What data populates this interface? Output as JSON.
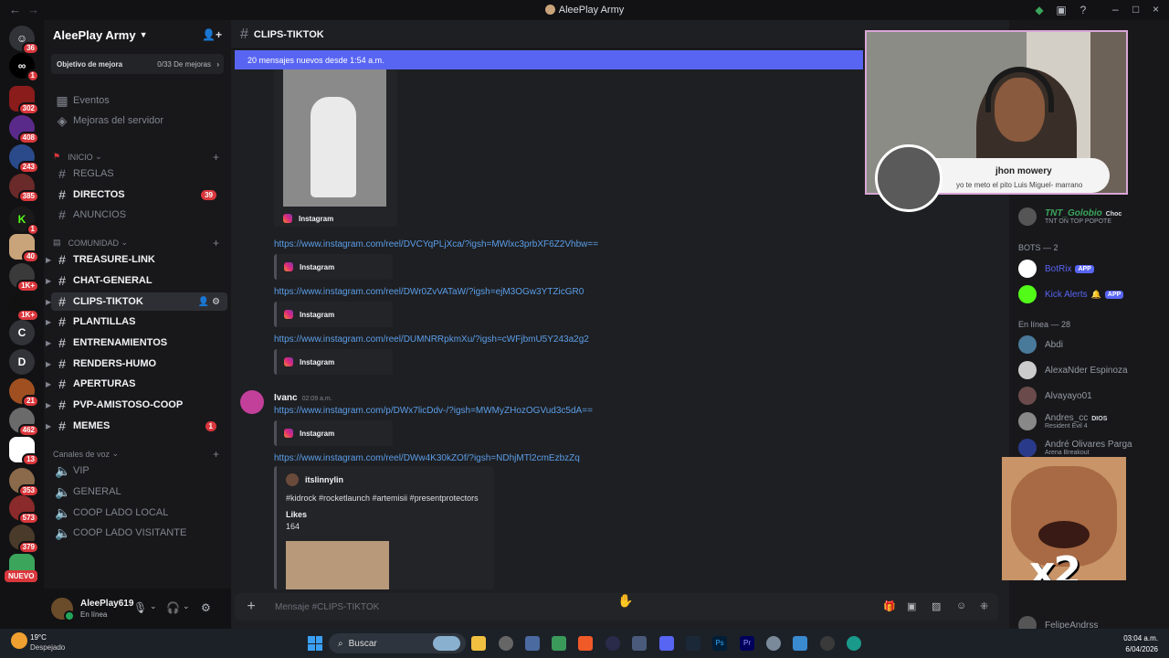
{
  "window": {
    "title": "AleePlay Army"
  },
  "servers": {
    "badges": [
      "36",
      "1",
      "302",
      "408",
      "243",
      "385",
      "1",
      "40",
      "1K+",
      "1K+",
      "21",
      "462",
      "13",
      "353",
      "573",
      "379"
    ],
    "letters": [
      "C",
      "D"
    ],
    "nuevo": "NUEVO"
  },
  "guild": {
    "name": "AleePlay Army"
  },
  "boost": {
    "label": "Objetivo de mejora",
    "progress": "0/33 De mejoras"
  },
  "nav": {
    "events": "Eventos",
    "boosts": "Mejoras del servidor"
  },
  "categories": {
    "inicio": "INICIO",
    "comunidad": "COMUNIDAD",
    "voz": "Canales de voz"
  },
  "channels": [
    {
      "name": "REGLAS"
    },
    {
      "name": "DIRECTOS",
      "count": "39"
    },
    {
      "name": "ANUNCIOS"
    },
    {
      "name": "TREASURE-LINK"
    },
    {
      "name": "CHAT-GENERAL"
    },
    {
      "name": "CLIPS-TIKTOK"
    },
    {
      "name": "PLANTILLAS"
    },
    {
      "name": "ENTRENAMIENTOS"
    },
    {
      "name": "RENDERS-HUMO"
    },
    {
      "name": "APERTURAS"
    },
    {
      "name": "PVP-AMISTOSO-COOP"
    },
    {
      "name": "MEMES",
      "count": "1"
    }
  ],
  "voice": [
    "VIP",
    "GENERAL",
    "COOP LADO LOCAL",
    "COOP LADO VISITANTE"
  ],
  "user": {
    "name": "AleePlay619",
    "status": "En línea"
  },
  "channel_header": {
    "name": "CLIPS-TIKTOK"
  },
  "new_messages": "20 mensajes nuevos desde 1:54 a.m.",
  "messages": {
    "instagram": "Instagram",
    "links": [
      "https://www.instagram.com/reel/DVCYqPLjXca/?igsh=MWlxc3prbXF6Z2Vhbw==",
      "https://www.instagram.com/reel/DWr0ZvVATaW/?igsh=ejM3OGw3YTZicGR0",
      "https://www.instagram.com/reel/DUMNRRpkmXu/?igsh=cWFjbmU5Y243a2g2",
      "https://www.instagram.com/p/DWx7licDdv-/?igsh=MWMyZHozOGVud3c5dA==",
      "https://www.instagram.com/reel/DWw4K30kZOf/?igsh=NDhjMTl2cmEzbzZq"
    ],
    "author": "Ivanc",
    "timestamp": "02:09 a.m.",
    "embed": {
      "user": "itslinnylin",
      "tags": "#kidrock #rocketlaunch #artemisii #presentprotectors",
      "likes_label": "Likes",
      "likes": "164"
    }
  },
  "composer": {
    "placeholder": "Mensaje #CLIPS-TIKTOK"
  },
  "members": {
    "top": {
      "name": "TNT_Golobio",
      "tag": "Choc",
      "status": "TNT ON TOP POPOTE"
    },
    "bots_header": "BOTS — 2",
    "bots": [
      {
        "name": "BotRix",
        "tag": "APP"
      },
      {
        "name": "Kick Alerts",
        "tag": "APP"
      }
    ],
    "online_header": "En línea — 28",
    "online": [
      {
        "name": "Abdi"
      },
      {
        "name": "AlexaNder Espinoza"
      },
      {
        "name": "Alvayayo01"
      },
      {
        "name": "Andres_cc",
        "tag": "DIOS",
        "sub": "Resident Evil 4"
      },
      {
        "name": "André Olivares Parga",
        "sub": "Arena Breakout"
      },
      {
        "name": "FelipeAndrss"
      }
    ]
  },
  "overlay": {
    "alert_name": "jhon mowery",
    "alert_text": "yo te meto el pito Luis Miguel- marrano",
    "meme_text": "x2"
  },
  "taskbar": {
    "temp": "19°C",
    "weather": "Despejado",
    "search": "Buscar",
    "time": "03:04 a.m.",
    "date": "6/04/2026"
  },
  "colors": {
    "accent": "#5865f2",
    "link": "#5b9ee9",
    "mention": "#da373c",
    "online": "#23a55a"
  }
}
